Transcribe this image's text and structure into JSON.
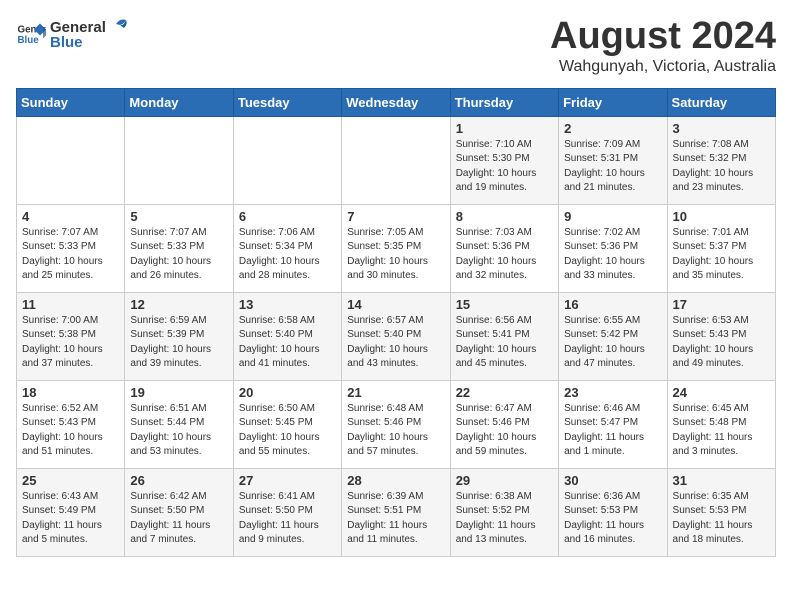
{
  "header": {
    "logo_general": "General",
    "logo_blue": "Blue",
    "title": "August 2024",
    "subtitle": "Wahgunyah, Victoria, Australia"
  },
  "calendar": {
    "weekdays": [
      "Sunday",
      "Monday",
      "Tuesday",
      "Wednesday",
      "Thursday",
      "Friday",
      "Saturday"
    ],
    "weeks": [
      [
        {
          "day": "",
          "info": ""
        },
        {
          "day": "",
          "info": ""
        },
        {
          "day": "",
          "info": ""
        },
        {
          "day": "",
          "info": ""
        },
        {
          "day": "1",
          "info": "Sunrise: 7:10 AM\nSunset: 5:30 PM\nDaylight: 10 hours\nand 19 minutes."
        },
        {
          "day": "2",
          "info": "Sunrise: 7:09 AM\nSunset: 5:31 PM\nDaylight: 10 hours\nand 21 minutes."
        },
        {
          "day": "3",
          "info": "Sunrise: 7:08 AM\nSunset: 5:32 PM\nDaylight: 10 hours\nand 23 minutes."
        }
      ],
      [
        {
          "day": "4",
          "info": "Sunrise: 7:07 AM\nSunset: 5:33 PM\nDaylight: 10 hours\nand 25 minutes."
        },
        {
          "day": "5",
          "info": "Sunrise: 7:07 AM\nSunset: 5:33 PM\nDaylight: 10 hours\nand 26 minutes."
        },
        {
          "day": "6",
          "info": "Sunrise: 7:06 AM\nSunset: 5:34 PM\nDaylight: 10 hours\nand 28 minutes."
        },
        {
          "day": "7",
          "info": "Sunrise: 7:05 AM\nSunset: 5:35 PM\nDaylight: 10 hours\nand 30 minutes."
        },
        {
          "day": "8",
          "info": "Sunrise: 7:03 AM\nSunset: 5:36 PM\nDaylight: 10 hours\nand 32 minutes."
        },
        {
          "day": "9",
          "info": "Sunrise: 7:02 AM\nSunset: 5:36 PM\nDaylight: 10 hours\nand 33 minutes."
        },
        {
          "day": "10",
          "info": "Sunrise: 7:01 AM\nSunset: 5:37 PM\nDaylight: 10 hours\nand 35 minutes."
        }
      ],
      [
        {
          "day": "11",
          "info": "Sunrise: 7:00 AM\nSunset: 5:38 PM\nDaylight: 10 hours\nand 37 minutes."
        },
        {
          "day": "12",
          "info": "Sunrise: 6:59 AM\nSunset: 5:39 PM\nDaylight: 10 hours\nand 39 minutes."
        },
        {
          "day": "13",
          "info": "Sunrise: 6:58 AM\nSunset: 5:40 PM\nDaylight: 10 hours\nand 41 minutes."
        },
        {
          "day": "14",
          "info": "Sunrise: 6:57 AM\nSunset: 5:40 PM\nDaylight: 10 hours\nand 43 minutes."
        },
        {
          "day": "15",
          "info": "Sunrise: 6:56 AM\nSunset: 5:41 PM\nDaylight: 10 hours\nand 45 minutes."
        },
        {
          "day": "16",
          "info": "Sunrise: 6:55 AM\nSunset: 5:42 PM\nDaylight: 10 hours\nand 47 minutes."
        },
        {
          "day": "17",
          "info": "Sunrise: 6:53 AM\nSunset: 5:43 PM\nDaylight: 10 hours\nand 49 minutes."
        }
      ],
      [
        {
          "day": "18",
          "info": "Sunrise: 6:52 AM\nSunset: 5:43 PM\nDaylight: 10 hours\nand 51 minutes."
        },
        {
          "day": "19",
          "info": "Sunrise: 6:51 AM\nSunset: 5:44 PM\nDaylight: 10 hours\nand 53 minutes."
        },
        {
          "day": "20",
          "info": "Sunrise: 6:50 AM\nSunset: 5:45 PM\nDaylight: 10 hours\nand 55 minutes."
        },
        {
          "day": "21",
          "info": "Sunrise: 6:48 AM\nSunset: 5:46 PM\nDaylight: 10 hours\nand 57 minutes."
        },
        {
          "day": "22",
          "info": "Sunrise: 6:47 AM\nSunset: 5:46 PM\nDaylight: 10 hours\nand 59 minutes."
        },
        {
          "day": "23",
          "info": "Sunrise: 6:46 AM\nSunset: 5:47 PM\nDaylight: 11 hours\nand 1 minute."
        },
        {
          "day": "24",
          "info": "Sunrise: 6:45 AM\nSunset: 5:48 PM\nDaylight: 11 hours\nand 3 minutes."
        }
      ],
      [
        {
          "day": "25",
          "info": "Sunrise: 6:43 AM\nSunset: 5:49 PM\nDaylight: 11 hours\nand 5 minutes."
        },
        {
          "day": "26",
          "info": "Sunrise: 6:42 AM\nSunset: 5:50 PM\nDaylight: 11 hours\nand 7 minutes."
        },
        {
          "day": "27",
          "info": "Sunrise: 6:41 AM\nSunset: 5:50 PM\nDaylight: 11 hours\nand 9 minutes."
        },
        {
          "day": "28",
          "info": "Sunrise: 6:39 AM\nSunset: 5:51 PM\nDaylight: 11 hours\nand 11 minutes."
        },
        {
          "day": "29",
          "info": "Sunrise: 6:38 AM\nSunset: 5:52 PM\nDaylight: 11 hours\nand 13 minutes."
        },
        {
          "day": "30",
          "info": "Sunrise: 6:36 AM\nSunset: 5:53 PM\nDaylight: 11 hours\nand 16 minutes."
        },
        {
          "day": "31",
          "info": "Sunrise: 6:35 AM\nSunset: 5:53 PM\nDaylight: 11 hours\nand 18 minutes."
        }
      ]
    ]
  }
}
